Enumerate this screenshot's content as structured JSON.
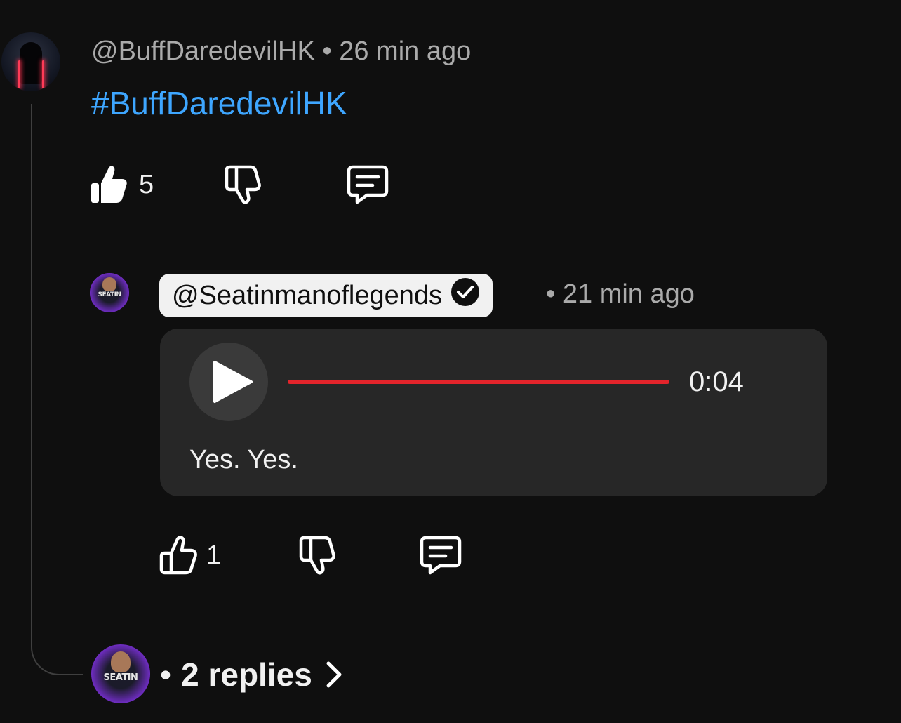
{
  "comment": {
    "author": "@BuffDaredevilHK",
    "separator": "•",
    "time": "26 min ago",
    "body": "#BuffDaredevilHK",
    "like_count": "5"
  },
  "reply": {
    "author": "@Seatinmanoflegends",
    "separator": "•",
    "time": "21 min ago",
    "avatar_text": "SEATIN",
    "audio": {
      "duration": "0:04",
      "progress_fraction": 1.0,
      "transcript": "Yes. Yes."
    },
    "like_count": "1"
  },
  "replies_link": {
    "separator": "•",
    "label": "2 replies",
    "avatar_text": "SEATIN"
  },
  "colors": {
    "background": "#0f0f0f",
    "hashtag": "#3ea6ff",
    "progress": "#e3242b",
    "card": "#272727"
  },
  "icons": [
    "thumbs-up-filled-icon",
    "thumbs-down-icon",
    "comment-icon",
    "thumbs-up-icon",
    "play-icon",
    "verified-check-icon",
    "chevron-right-icon"
  ]
}
